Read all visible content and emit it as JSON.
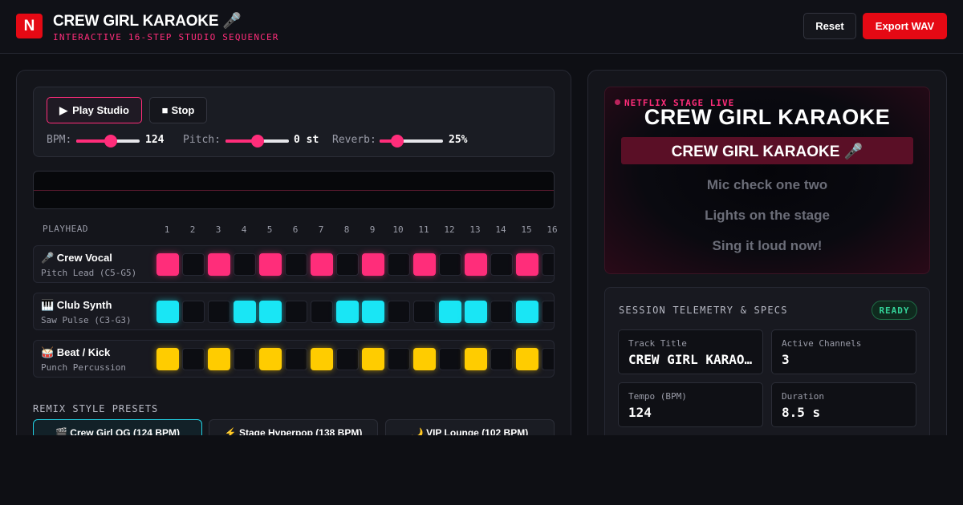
{
  "header": {
    "logo": "N",
    "title": "CREW GIRL KARAOKE 🎤",
    "subtitle": "INTERACTIVE 16-STEP STUDIO SEQUENCER",
    "reset_label": "Reset",
    "export_label": "Export WAV"
  },
  "transport": {
    "play_icon": "▶",
    "play_label": "Play Studio",
    "stop_icon": "■",
    "stop_label": "Stop",
    "bpm_label": "BPM:",
    "bpm_value": "124",
    "bpm_fraction": 0.55,
    "pitch_label": "Pitch:",
    "pitch_value": "0 st",
    "pitch_fraction": 0.5,
    "reverb_label": "Reverb:",
    "reverb_value": "25%",
    "reverb_fraction": 0.28
  },
  "sequencer": {
    "playhead_label": "PLAYHEAD",
    "steps": [
      "1",
      "2",
      "3",
      "4",
      "5",
      "6",
      "7",
      "8",
      "9",
      "10",
      "11",
      "12",
      "13",
      "14",
      "15",
      "16"
    ],
    "tracks": [
      {
        "name": "🎤 Crew Vocal",
        "sub": "Pitch Lead (C5-G5)",
        "color": "#ff2d7a",
        "pattern": [
          1,
          0,
          1,
          0,
          1,
          0,
          1,
          0,
          1,
          0,
          1,
          0,
          1,
          0,
          1,
          0
        ]
      },
      {
        "name": "🎹 Club Synth",
        "sub": "Saw Pulse (C3-G3)",
        "color": "#19e6f5",
        "pattern": [
          1,
          0,
          0,
          1,
          1,
          0,
          0,
          1,
          1,
          0,
          0,
          1,
          1,
          0,
          1,
          0
        ]
      },
      {
        "name": "🥁 Beat / Kick",
        "sub": "Punch Percussion",
        "color": "#ffcc00",
        "pattern": [
          1,
          0,
          1,
          0,
          1,
          0,
          1,
          0,
          1,
          0,
          1,
          0,
          1,
          0,
          1,
          0
        ]
      }
    ]
  },
  "presets": {
    "label": "REMIX STYLE PRESETS",
    "items": [
      "🎬 Crew Girl OG (124 BPM)",
      "⚡ Stage Hyperpop (138 BPM)",
      "🌙 VIP Lounge (102 BPM)"
    ],
    "active_index": 0
  },
  "screen": {
    "live_label": "NETFLIX STAGE LIVE",
    "title": "CREW GIRL KARAOKE",
    "active_lyric": "CREW GIRL KARAOKE 🎤",
    "lyrics": [
      "Mic check one two",
      "Lights on the stage",
      "Sing it loud now!"
    ]
  },
  "telemetry": {
    "title": "SESSION TELEMETRY & SPECS",
    "status": "READY",
    "stats": [
      {
        "label": "Track Title",
        "value": "CREW GIRL KARAOKE"
      },
      {
        "label": "Active Channels",
        "value": "3"
      },
      {
        "label": "Tempo (BPM)",
        "value": "124"
      },
      {
        "label": "Duration",
        "value": "8.5 s"
      }
    ]
  },
  "colors": {
    "accent": "#ff2d7a",
    "brand": "#e50914",
    "ready": "#34d399"
  }
}
